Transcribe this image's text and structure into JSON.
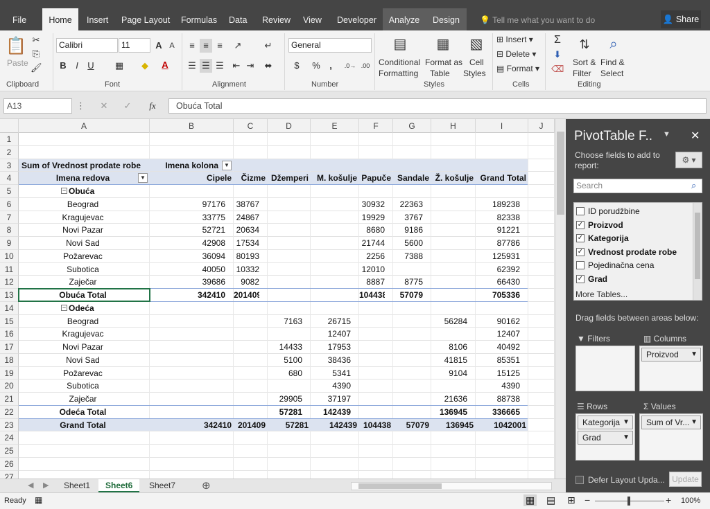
{
  "ribbon_tabs": [
    "File",
    "Home",
    "Insert",
    "Page Layout",
    "Formulas",
    "Data",
    "Review",
    "View",
    "Developer",
    "Analyze",
    "Design"
  ],
  "tell_me": "Tell me what you want to do",
  "share_label": "Share",
  "ribbon": {
    "paste": "Paste",
    "clipboard": "Clipboard",
    "font_name": "Calibri",
    "font_size": "11",
    "font": "Font",
    "alignment": "Alignment",
    "number_format": "General",
    "number": "Number",
    "cond_fmt_1": "Conditional",
    "cond_fmt_2": "Formatting",
    "fmt_table_1": "Format as",
    "fmt_table_2": "Table",
    "cell_styles_1": "Cell",
    "cell_styles_2": "Styles",
    "styles": "Styles",
    "insert": "Insert",
    "delete": "Delete",
    "format": "Format",
    "cells": "Cells",
    "sort_1": "Sort &",
    "sort_2": "Filter",
    "find_1": "Find &",
    "find_2": "Select",
    "editing": "Editing"
  },
  "formula_bar": {
    "name_box": "A13",
    "formula": "Obuća Total"
  },
  "columns": [
    "A",
    "B",
    "C",
    "D",
    "E",
    "F",
    "G",
    "H",
    "I",
    "J"
  ],
  "rows": [
    "1",
    "2",
    "3",
    "4",
    "5",
    "6",
    "7",
    "8",
    "9",
    "10",
    "11",
    "12",
    "13",
    "14",
    "15",
    "16",
    "17",
    "18",
    "19",
    "20",
    "21",
    "22",
    "23",
    "24",
    "25",
    "26",
    "27"
  ],
  "pivot": {
    "corner_label": "Sum of Vrednost prodate robe",
    "col_label": "Imena kolona",
    "row_label": "Imena redova",
    "headers": [
      "Cipele",
      "Čizme",
      "Džemperi",
      "M. košulje",
      "Papuče",
      "Sandale",
      "Ž. košulje",
      "Grand Total"
    ],
    "groups": [
      {
        "name": "Obuća",
        "rows": [
          {
            "city": "Beograd",
            "vals": [
              "97176",
              "38767",
              "",
              "",
              "30932",
              "22363",
              "",
              "189238"
            ]
          },
          {
            "city": "Kragujevac",
            "vals": [
              "33775",
              "24867",
              "",
              "",
              "19929",
              "3767",
              "",
              "82338"
            ]
          },
          {
            "city": "Novi Pazar",
            "vals": [
              "52721",
              "20634",
              "",
              "",
              "8680",
              "9186",
              "",
              "91221"
            ]
          },
          {
            "city": "Novi Sad",
            "vals": [
              "42908",
              "17534",
              "",
              "",
              "21744",
              "5600",
              "",
              "87786"
            ]
          },
          {
            "city": "Požarevac",
            "vals": [
              "36094",
              "80193",
              "",
              "",
              "2256",
              "7388",
              "",
              "125931"
            ]
          },
          {
            "city": "Subotica",
            "vals": [
              "40050",
              "10332",
              "",
              "",
              "12010",
              "",
              "",
              "62392"
            ]
          },
          {
            "city": "Zaječar",
            "vals": [
              "39686",
              "9082",
              "",
              "",
              "8887",
              "8775",
              "",
              "66430"
            ]
          }
        ],
        "total_label": "Obuća Total",
        "total": [
          "342410",
          "201409",
          "",
          "",
          "104438",
          "57079",
          "",
          "705336"
        ]
      },
      {
        "name": "Odeća",
        "rows": [
          {
            "city": "Beograd",
            "vals": [
              "",
              "",
              "7163",
              "26715",
              "",
              "",
              "56284",
              "90162"
            ]
          },
          {
            "city": "Kragujevac",
            "vals": [
              "",
              "",
              "",
              "12407",
              "",
              "",
              "",
              "12407"
            ]
          },
          {
            "city": "Novi Pazar",
            "vals": [
              "",
              "",
              "14433",
              "17953",
              "",
              "",
              "8106",
              "40492"
            ]
          },
          {
            "city": "Novi Sad",
            "vals": [
              "",
              "",
              "5100",
              "38436",
              "",
              "",
              "41815",
              "85351"
            ]
          },
          {
            "city": "Požarevac",
            "vals": [
              "",
              "",
              "680",
              "5341",
              "",
              "",
              "9104",
              "15125"
            ]
          },
          {
            "city": "Subotica",
            "vals": [
              "",
              "",
              "",
              "4390",
              "",
              "",
              "",
              "4390"
            ]
          },
          {
            "city": "Zaječar",
            "vals": [
              "",
              "",
              "29905",
              "37197",
              "",
              "",
              "21636",
              "88738"
            ]
          }
        ],
        "total_label": "Odeća Total",
        "total": [
          "",
          "",
          "57281",
          "142439",
          "",
          "",
          "136945",
          "336665"
        ]
      }
    ],
    "grand_label": "Grand Total",
    "grand": [
      "342410",
      "201409",
      "57281",
      "142439",
      "104438",
      "57079",
      "136945",
      "1042001"
    ]
  },
  "sheets": [
    "Sheet1",
    "Sheet6",
    "Sheet7"
  ],
  "active_sheet": "Sheet6",
  "status": {
    "ready": "Ready",
    "zoom": "100%"
  },
  "pivot_pane": {
    "title": "PivotTable F..",
    "choose": "Choose fields to add to report:",
    "search_placeholder": "Search",
    "fields": [
      {
        "name": "ID porudžbine",
        "checked": false
      },
      {
        "name": "Proizvod",
        "checked": true
      },
      {
        "name": "Kategorija",
        "checked": true
      },
      {
        "name": "Vrednost prodate robe",
        "checked": true
      },
      {
        "name": "Pojedinačna cena",
        "checked": false
      },
      {
        "name": "Grad",
        "checked": true
      }
    ],
    "more_tables": "More Tables...",
    "drag_label": "Drag fields between areas below:",
    "filters": "Filters",
    "columns": "Columns",
    "rows": "Rows",
    "values": "Values",
    "columns_fields": [
      "Proizvod"
    ],
    "rows_fields": [
      "Kategorija",
      "Grad"
    ],
    "values_fields": [
      "Sum of Vr..."
    ],
    "defer": "Defer Layout Upda...",
    "update": "Update"
  },
  "colors": {
    "pivot_header_bg": "#dce3f0",
    "pivot_line": "#8ea9db",
    "dark_chrome": "#454545"
  }
}
